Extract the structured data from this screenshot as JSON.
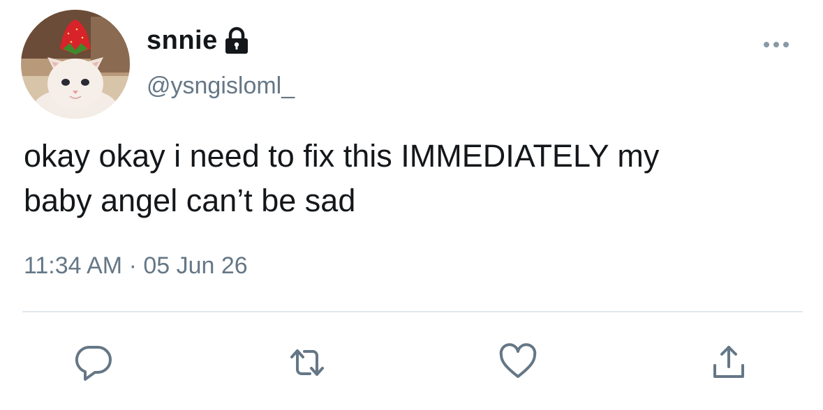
{
  "user": {
    "display_name": "snnie",
    "handle": "@ysngisloml_",
    "avatar": "kitten-with-strawberry-avatar",
    "protected_icon": "lock-icon"
  },
  "tweet": {
    "text_lines": [
      "okay okay i need to fix this IMMEDIATELY my",
      "baby angel can’t be sad"
    ],
    "timestamp": "11:34 AM · 05 Jun 26"
  },
  "actions": {
    "more": "more-icon",
    "reply": "reply-icon",
    "retweet": "retweet-icon",
    "like": "heart-icon",
    "share": "share-icon"
  },
  "colors": {
    "text": "#14171a",
    "secondary": "#657786",
    "divider": "#e1e8ed",
    "icon": "#657786"
  }
}
